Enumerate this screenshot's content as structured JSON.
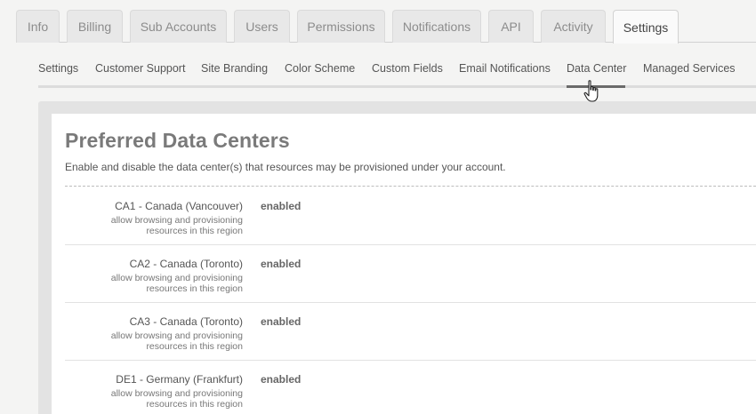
{
  "top_tabs": [
    {
      "label": "Info"
    },
    {
      "label": "Billing"
    },
    {
      "label": "Sub Accounts"
    },
    {
      "label": "Users"
    },
    {
      "label": "Permissions"
    },
    {
      "label": "Notifications"
    },
    {
      "label": "API"
    },
    {
      "label": "Activity"
    },
    {
      "label": "Settings",
      "active": true
    }
  ],
  "subnav": [
    {
      "label": "Settings"
    },
    {
      "label": "Customer Support"
    },
    {
      "label": "Site Branding"
    },
    {
      "label": "Color Scheme"
    },
    {
      "label": "Custom Fields"
    },
    {
      "label": "Email Notifications"
    },
    {
      "label": "Data Center",
      "active": true
    },
    {
      "label": "Managed Services"
    }
  ],
  "page": {
    "title": "Preferred Data Centers",
    "description": "Enable and disable the data center(s) that resources may be provisioned under your account."
  },
  "data_centers": [
    {
      "name": "CA1 - Canada (Vancouver)",
      "hint": "allow browsing and provisioning resources in this region",
      "status": "enabled"
    },
    {
      "name": "CA2 - Canada (Toronto)",
      "hint": "allow browsing and provisioning resources in this region",
      "status": "enabled"
    },
    {
      "name": "CA3 - Canada (Toronto)",
      "hint": "allow browsing and provisioning resources in this region",
      "status": "enabled"
    },
    {
      "name": "DE1 - Germany (Frankfurt)",
      "hint": "allow browsing and provisioning resources in this region",
      "status": "enabled"
    }
  ],
  "icons": {
    "cursor": "hand-pointer-icon"
  }
}
